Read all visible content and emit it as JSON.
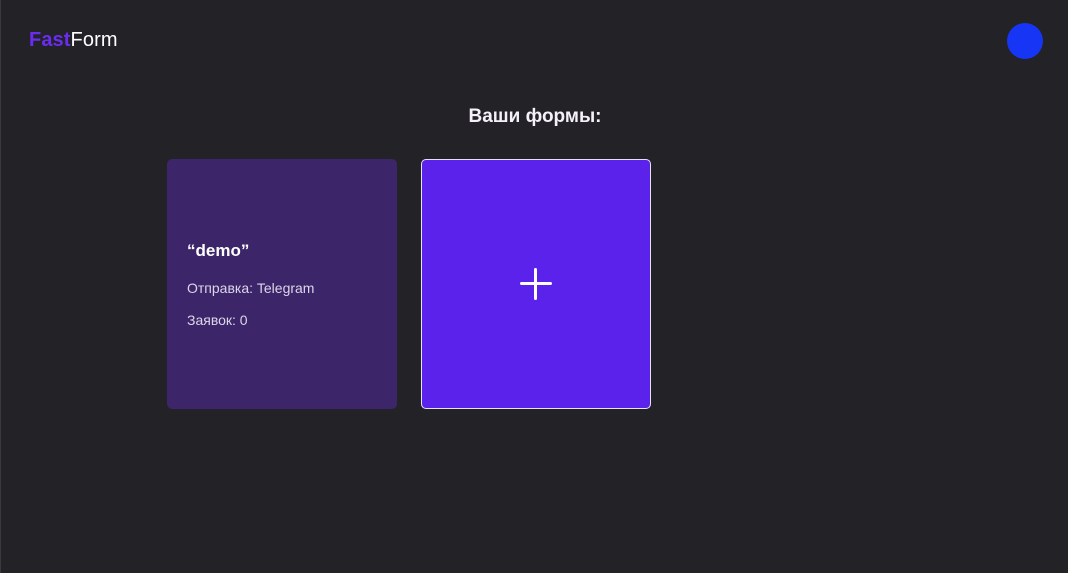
{
  "header": {
    "logo": {
      "part_accent": "Fast",
      "part_plain": "Form"
    },
    "avatar": {
      "color": "#1735f5",
      "icon": "user-avatar"
    }
  },
  "main": {
    "title": "Ваши формы:",
    "forms": [
      {
        "name": "“demo”",
        "delivery": "Отправка: Telegram",
        "submissions": "Заявок: 0"
      }
    ],
    "add_card": {
      "icon": "plus-icon"
    }
  },
  "colors": {
    "background": "#232226",
    "accent": "#6a2cf0",
    "form_card": "#3c2569",
    "add_card": "#5a22ea"
  }
}
